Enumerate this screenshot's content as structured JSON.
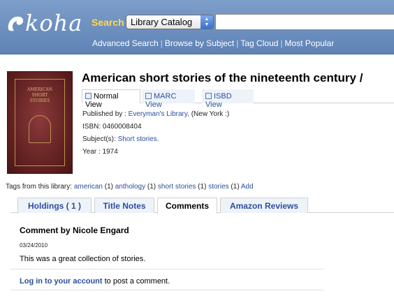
{
  "header": {
    "logo_text": "koha",
    "search_label": "Search",
    "catalog_select": "Library Catalog",
    "search_input_value": "",
    "links": [
      "Advanced Search",
      "Browse by Subject",
      "Tag Cloud",
      "Most Popular"
    ]
  },
  "record": {
    "title": "American short stories of the nineteenth century /",
    "view_tabs": [
      "Normal View",
      "MARC View",
      "ISBD View"
    ],
    "published_label": "Published by :",
    "publisher": "Everyman's Library,",
    "publisher_place": "(New York :)",
    "isbn": "ISBN: 0460008404",
    "subjects_label": "Subject(s):",
    "subject": "Short stories.",
    "year": "Year : 1974"
  },
  "cover": {
    "lines": [
      "AMERICAN",
      "SHORT",
      "STORIES"
    ]
  },
  "tags": {
    "label": "Tags from this library:",
    "items": [
      {
        "name": "american",
        "count": "(1)"
      },
      {
        "name": "anthology",
        "count": "(1)"
      },
      {
        "name": "short stories",
        "count": "(1)"
      },
      {
        "name": "stories",
        "count": "(1)"
      }
    ],
    "add": "Add"
  },
  "tabs": [
    "Holdings ( 1 )",
    "Title Notes",
    "Comments",
    "Amazon Reviews"
  ],
  "comment": {
    "title": "Comment by Nicole Engard",
    "date": "03/24/2010",
    "body": "This was a great collection of stories.",
    "login_link": "Log in to your account",
    "login_suffix": " to post a comment."
  },
  "colors": {
    "header_bg": "#6b8fc2",
    "search_label": "#ffd84d",
    "link": "#2a4f9c"
  }
}
